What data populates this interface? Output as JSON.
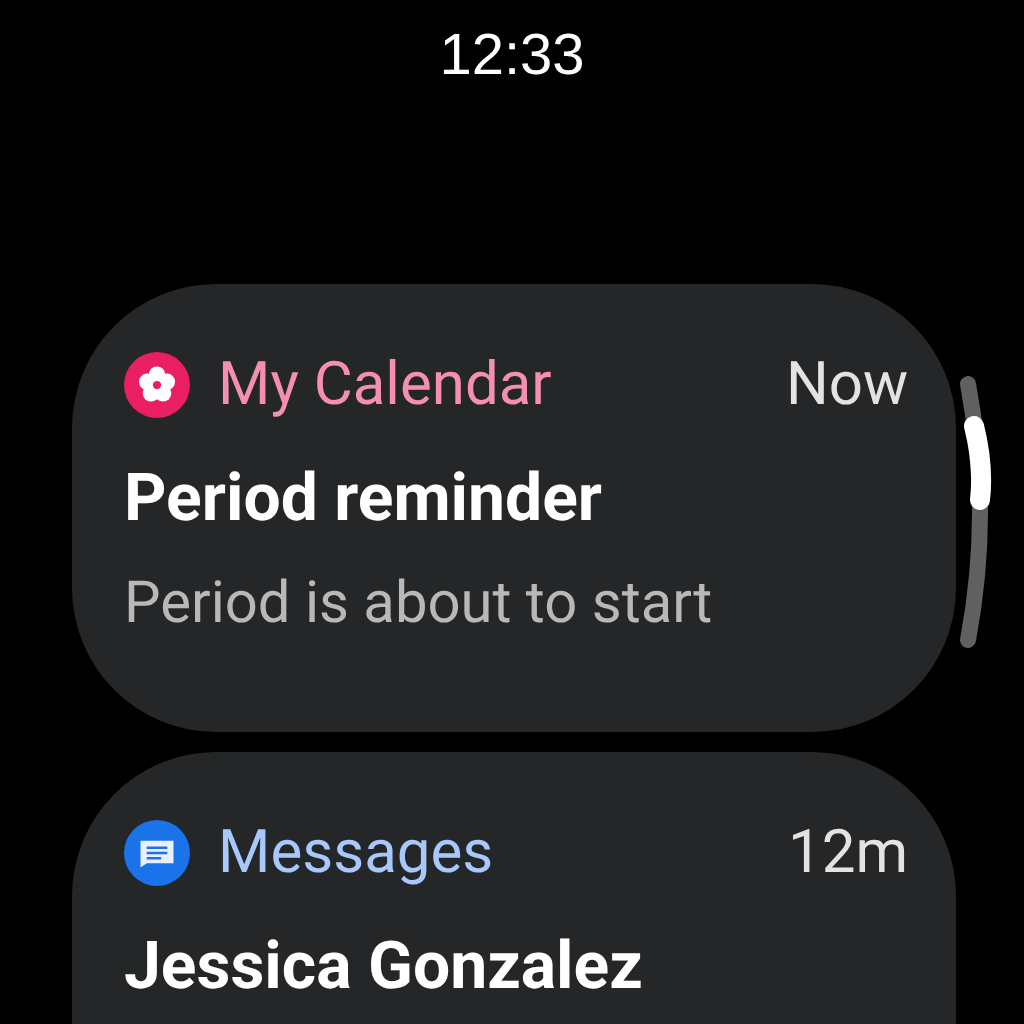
{
  "time": "12:33",
  "notifications": [
    {
      "app": "My Calendar",
      "kind": "calendar",
      "color": "#f48fb1",
      "when": "Now",
      "title": "Period reminder",
      "body": "Period is about to start"
    },
    {
      "app": "Messages",
      "kind": "messages",
      "color": "#a8c7fa",
      "when": "12m",
      "title": "Jessica Gonzalez"
    }
  ]
}
